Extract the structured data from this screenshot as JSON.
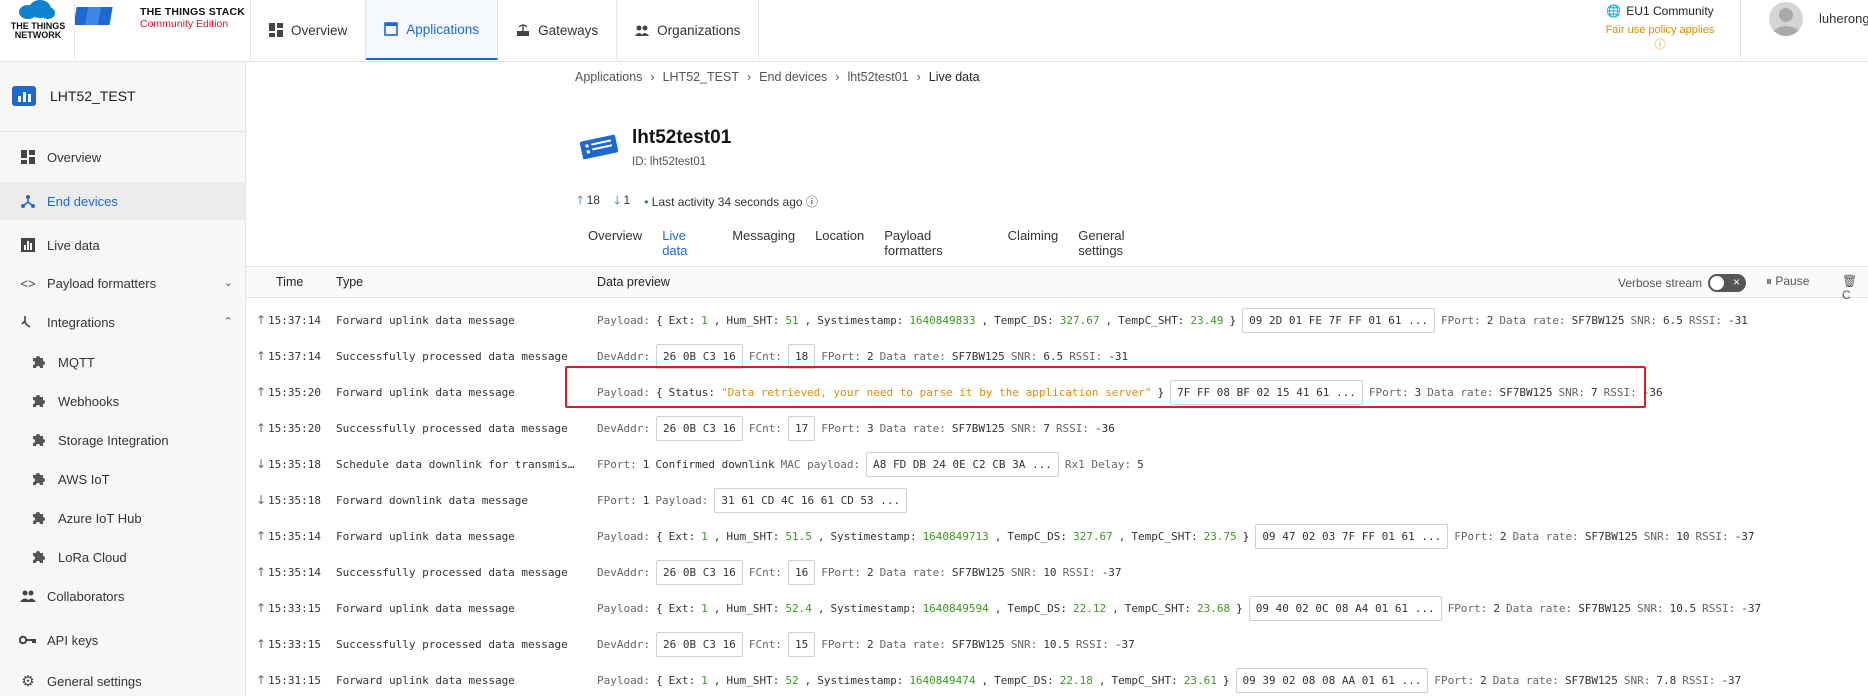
{
  "brand": {
    "ttn_text": "THE THINGS NETWORK",
    "stack_title": "THE THINGS STACK",
    "stack_edition": "Community Edition"
  },
  "nav": [
    {
      "label": "Overview",
      "icon": "dashboard-icon"
    },
    {
      "label": "Applications",
      "icon": "application-icon",
      "active": true
    },
    {
      "label": "Gateways",
      "icon": "gateway-icon"
    },
    {
      "label": "Organizations",
      "icon": "organization-icon"
    }
  ],
  "cluster": {
    "name": "EU1 Community",
    "fair_use": "Fair use policy applies"
  },
  "user": {
    "name": "luherong"
  },
  "sidebar": {
    "app_name": "LHT52_TEST",
    "items": [
      {
        "label": "Overview"
      },
      {
        "label": "End devices"
      },
      {
        "label": "Live data"
      },
      {
        "label": "Payload formatters"
      },
      {
        "label": "Integrations"
      },
      {
        "label": "MQTT"
      },
      {
        "label": "Webhooks"
      },
      {
        "label": "Storage Integration"
      },
      {
        "label": "AWS IoT"
      },
      {
        "label": "Azure IoT Hub"
      },
      {
        "label": "LoRa Cloud"
      },
      {
        "label": "Collaborators"
      },
      {
        "label": "API keys"
      },
      {
        "label": "General settings"
      }
    ]
  },
  "breadcrumbs": [
    "Applications",
    "LHT52_TEST",
    "End devices",
    "lht52test01",
    "Live data"
  ],
  "device": {
    "title": "lht52test01",
    "id_label": "ID:",
    "id": "lht52test01",
    "uplinks": "18",
    "downlinks": "1",
    "last_activity": "Last activity 34 seconds ago"
  },
  "tabs": [
    "Overview",
    "Live data",
    "Messaging",
    "Location",
    "Payload formatters",
    "Claiming",
    "General settings"
  ],
  "table": {
    "headers": {
      "time": "Time",
      "type": "Type",
      "data": "Data preview"
    },
    "verbose": "Verbose stream",
    "pause": "Pause",
    "clear": "C"
  },
  "rows": [
    {
      "dir": "up",
      "time": "15:37:14",
      "type": "Forward uplink data message",
      "payload": {
        "ext": "1",
        "hum": "51",
        "ts": "1640849833",
        "tds": "327.67",
        "tsht": "23.49"
      },
      "hex": "09 2D 01 FE 7F FF 01 61 ...",
      "fport": "2",
      "rate": "SF7BW125",
      "snr": "6.5",
      "rssi": "-31"
    },
    {
      "dir": "up",
      "time": "15:37:14",
      "type": "Successfully processed data message",
      "devaddr": "26 0B C3 16",
      "fcnt": "18",
      "fport": "2",
      "rate": "SF7BW125",
      "snr": "6.5",
      "rssi": "-31"
    },
    {
      "dir": "up",
      "time": "15:35:20",
      "type": "Forward uplink data message",
      "status": "\"Data retrieved, your need to parse it by the application server\"",
      "hex": "7F FF 08 BF 02 15 41 61 ...",
      "fport": "3",
      "rate": "SF7BW125",
      "snr": "7",
      "rssi": "-36"
    },
    {
      "dir": "up",
      "time": "15:35:20",
      "type": "Successfully processed data message",
      "devaddr": "26 0B C3 16",
      "fcnt": "17",
      "fport": "3",
      "rate": "SF7BW125",
      "snr": "7",
      "rssi": "-36"
    },
    {
      "dir": "down",
      "time": "15:35:18",
      "type": "Schedule data downlink for transmission",
      "fport": "1",
      "confirmed": "Confirmed downlink",
      "mac": "A8 FD DB 24 0E C2 CB 3A ...",
      "rx1": "5"
    },
    {
      "dir": "down",
      "time": "15:35:18",
      "type": "Forward downlink data message",
      "fport": "1",
      "payload_hex": "31 61 CD 4C 16 61 CD 53 ..."
    },
    {
      "dir": "up",
      "time": "15:35:14",
      "type": "Forward uplink data message",
      "payload": {
        "ext": "1",
        "hum": "51.5",
        "ts": "1640849713",
        "tds": "327.67",
        "tsht": "23.75"
      },
      "hex": "09 47 02 03 7F FF 01 61 ...",
      "fport": "2",
      "rate": "SF7BW125",
      "snr": "10",
      "rssi": "-37"
    },
    {
      "dir": "up",
      "time": "15:35:14",
      "type": "Successfully processed data message",
      "devaddr": "26 0B C3 16",
      "fcnt": "16",
      "fport": "2",
      "rate": "SF7BW125",
      "snr": "10",
      "rssi": "-37"
    },
    {
      "dir": "up",
      "time": "15:33:15",
      "type": "Forward uplink data message",
      "payload": {
        "ext": "1",
        "hum": "52.4",
        "ts": "1640849594",
        "tds": "22.12",
        "tsht": "23.68"
      },
      "hex": "09 40 02 0C 08 A4 01 61 ...",
      "fport": "2",
      "rate": "SF7BW125",
      "snr": "10.5",
      "rssi": "-37"
    },
    {
      "dir": "up",
      "time": "15:33:15",
      "type": "Successfully processed data message",
      "devaddr": "26 0B C3 16",
      "fcnt": "15",
      "fport": "2",
      "rate": "SF7BW125",
      "snr": "10.5",
      "rssi": "-37"
    },
    {
      "dir": "up",
      "time": "15:31:15",
      "type": "Forward uplink data message",
      "payload": {
        "ext": "1",
        "hum": "52",
        "ts": "1640849474",
        "tds": "22.18",
        "tsht": "23.61"
      },
      "hex": "09 39 02 08 08 AA 01 61 ...",
      "fport": "2",
      "rate": "SF7BW125",
      "snr": "7.8",
      "rssi": "-37"
    }
  ],
  "labels": {
    "payload": "Payload:",
    "devaddr": "DevAddr:",
    "fcnt": "FCnt:",
    "fport": "FPort:",
    "rate": "Data rate:",
    "snr": "SNR:",
    "rssi": "RSSI:",
    "mac": "MAC payload:",
    "rx1": "Rx1 Delay:",
    "ext": "Ext:",
    "hum": "Hum_SHT:",
    "ts": "Systimestamp:",
    "tds": "TempC_DS:",
    "tsht": "TempC_SHT:",
    "status": "Status:"
  },
  "colors": {
    "accent": "#1c69d4",
    "number": "#3a9a1d",
    "string": "#e08d00",
    "highlight": "#e31d1d"
  }
}
